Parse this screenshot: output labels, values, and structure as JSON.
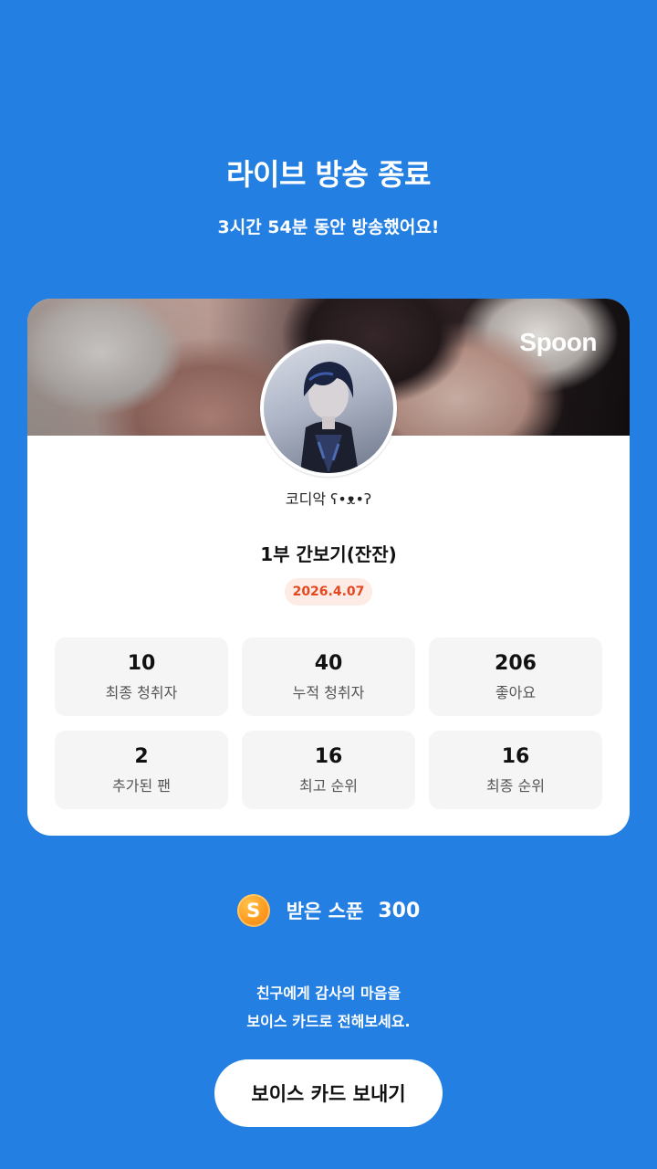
{
  "header": {
    "title": "라이브 방송 종료",
    "subtitle": "3시간 54분 동안 방송했어요!"
  },
  "card": {
    "brand": "Spoon",
    "nickname": "코디악 ʕ•ᴥ•ʔ",
    "live_title": "1부 간보기(잔잔)",
    "date": "2026.4.07",
    "stats": [
      {
        "value": "10",
        "label": "최종 청취자"
      },
      {
        "value": "40",
        "label": "누적 청취자"
      },
      {
        "value": "206",
        "label": "좋아요"
      },
      {
        "value": "2",
        "label": "추가된 팬"
      },
      {
        "value": "16",
        "label": "최고 순위"
      },
      {
        "value": "16",
        "label": "최종 순위"
      }
    ]
  },
  "spoons": {
    "icon_letter": "S",
    "label": "받은 스푼",
    "count": "300"
  },
  "message": {
    "line1": "친구에게 감사의 마음을",
    "line2": "보이스 카드로 전해보세요."
  },
  "actions": {
    "send_label": "보이스 카드 보내기"
  },
  "colors": {
    "background": "#237fe2",
    "date_badge_text": "#e5471f",
    "date_badge_bg": "#fdece6",
    "coin": "#ff9a1f"
  },
  "icons": {
    "coin": "spoon-coin-icon"
  }
}
